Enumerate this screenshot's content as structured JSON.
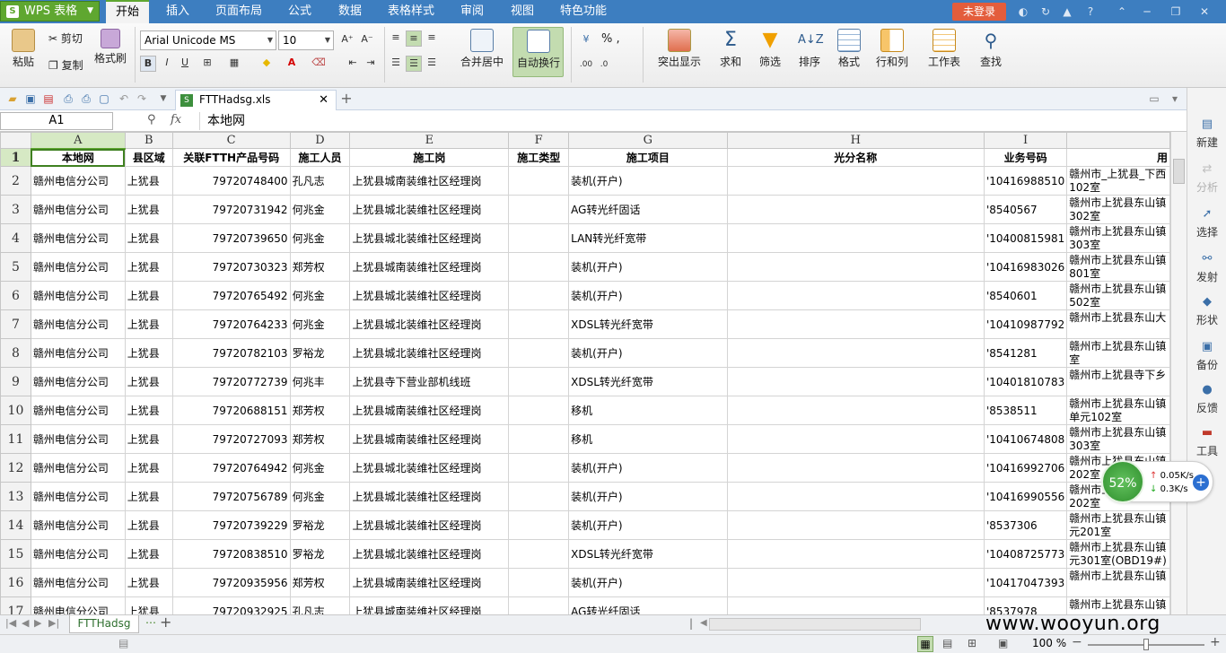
{
  "app": {
    "name": "WPS 表格",
    "login": "未登录"
  },
  "tabs": [
    "开始",
    "插入",
    "页面布局",
    "公式",
    "数据",
    "表格样式",
    "审阅",
    "视图",
    "特色功能"
  ],
  "ribbon": {
    "paste": "粘贴",
    "cut": "剪切",
    "copy": "复制",
    "format_painter": "格式刷",
    "font_name": "Arial Unicode MS",
    "font_size": "10",
    "merge_center": "合并居中",
    "auto_wrap": "自动换行",
    "highlight": "突出显示",
    "sum": "求和",
    "filter": "筛选",
    "sort": "排序",
    "format": "格式",
    "row_col": "行和列",
    "worksheet": "工作表",
    "find": "查找",
    "number_format": "% ,"
  },
  "document": {
    "tab_name": "FTTHadsg.xls"
  },
  "formula": {
    "cell_ref": "A1",
    "fx": "fx",
    "value": "本地网"
  },
  "columns": [
    "A",
    "B",
    "C",
    "D",
    "E",
    "F",
    "G",
    "H",
    "I",
    ""
  ],
  "header_row": [
    "本地网",
    "县区域",
    "关联FTTH产品号码",
    "施工人员",
    "施工岗",
    "施工类型",
    "施工项目",
    "光分名称",
    "业务号码",
    "用"
  ],
  "rows": [
    {
      "n": "2",
      "cells": [
        "赣州电信分公司",
        "上犹县",
        "79720748400",
        "孔凡志",
        "上犹县城南装维社区经理岗",
        "",
        "装机(开户)",
        "",
        "'10416988510",
        "赣州市_上犹县_下西102室"
      ]
    },
    {
      "n": "3",
      "cells": [
        "赣州电信分公司",
        "上犹县",
        "79720731942",
        "何兆金",
        "上犹县城北装维社区经理岗",
        "",
        "AG转光纤固话",
        "",
        "'8540567",
        "赣州市上犹县东山镇302室"
      ]
    },
    {
      "n": "4",
      "cells": [
        "赣州电信分公司",
        "上犹县",
        "79720739650",
        "何兆金",
        "上犹县城北装维社区经理岗",
        "",
        "LAN转光纤宽带",
        "",
        "'10400815981",
        "赣州市上犹县东山镇303室"
      ]
    },
    {
      "n": "5",
      "cells": [
        "赣州电信分公司",
        "上犹县",
        "79720730323",
        "郑芳权",
        "上犹县城南装维社区经理岗",
        "",
        "装机(开户)",
        "",
        "'10416983026",
        "赣州市上犹县东山镇801室"
      ]
    },
    {
      "n": "6",
      "cells": [
        "赣州电信分公司",
        "上犹县",
        "79720765492",
        "何兆金",
        "上犹县城北装维社区经理岗",
        "",
        "装机(开户)",
        "",
        "'8540601",
        "赣州市上犹县东山镇502室"
      ]
    },
    {
      "n": "7",
      "cells": [
        "赣州电信分公司",
        "上犹县",
        "79720764233",
        "何兆金",
        "上犹县城北装维社区经理岗",
        "",
        "XDSL转光纤宽带",
        "",
        "'10410987792",
        "赣州市上犹县东山大"
      ]
    },
    {
      "n": "8",
      "cells": [
        "赣州电信分公司",
        "上犹县",
        "79720782103",
        "罗裕龙",
        "上犹县城北装维社区经理岗",
        "",
        "装机(开户)",
        "",
        "'8541281",
        "赣州市上犹县东山镇室"
      ]
    },
    {
      "n": "9",
      "cells": [
        "赣州电信分公司",
        "上犹县",
        "79720772739",
        "何兆丰",
        "上犹县寺下营业部机线班",
        "",
        "XDSL转光纤宽带",
        "",
        "'10401810783",
        "赣州市上犹县寺下乡"
      ]
    },
    {
      "n": "10",
      "cells": [
        "赣州电信分公司",
        "上犹县",
        "79720688151",
        "郑芳权",
        "上犹县城南装维社区经理岗",
        "",
        "移机",
        "",
        "'8538511",
        "赣州市上犹县东山镇单元102室"
      ]
    },
    {
      "n": "11",
      "cells": [
        "赣州电信分公司",
        "上犹县",
        "79720727093",
        "郑芳权",
        "上犹县城南装维社区经理岗",
        "",
        "移机",
        "",
        "'10410674808",
        "赣州市上犹县东山镇303室"
      ]
    },
    {
      "n": "12",
      "cells": [
        "赣州电信分公司",
        "上犹县",
        "79720764942",
        "何兆金",
        "上犹县城北装维社区经理岗",
        "",
        "装机(开户)",
        "",
        "'10416992706",
        "赣州市上犹县东山镇202室"
      ]
    },
    {
      "n": "13",
      "cells": [
        "赣州电信分公司",
        "上犹县",
        "79720756789",
        "何兆金",
        "上犹县城北装维社区经理岗",
        "",
        "装机(开户)",
        "",
        "'10416990556",
        "赣州市上犹县东山镇202室"
      ]
    },
    {
      "n": "14",
      "cells": [
        "赣州电信分公司",
        "上犹县",
        "79720739229",
        "罗裕龙",
        "上犹县城北装维社区经理岗",
        "",
        "装机(开户)",
        "",
        "'8537306",
        "赣州市上犹县东山镇元201室"
      ]
    },
    {
      "n": "15",
      "cells": [
        "赣州电信分公司",
        "上犹县",
        "79720838510",
        "罗裕龙",
        "上犹县城北装维社区经理岗",
        "",
        "XDSL转光纤宽带",
        "",
        "'10408725773",
        "赣州市上犹县东山镇元301室(OBD19#)"
      ]
    },
    {
      "n": "16",
      "cells": [
        "赣州电信分公司",
        "上犹县",
        "79720935956",
        "郑芳权",
        "上犹县城南装维社区经理岗",
        "",
        "装机(开户)",
        "",
        "'10417047393",
        "赣州市上犹县东山镇"
      ]
    },
    {
      "n": "17",
      "cells": [
        "赣州电信分公司",
        "上犹县",
        "79720932925",
        "孔凡志",
        "上犹县城南装维社区经理岗",
        "",
        "AG转光纤固话",
        "",
        "'8537978",
        "赣州市上犹县东山镇"
      ]
    }
  ],
  "sidepanel": [
    "新建",
    "分析",
    "选择",
    "发射",
    "形状",
    "备份",
    "反馈",
    "工具"
  ],
  "sheet": {
    "name": "FTTHadsg"
  },
  "status": {
    "zoom": "100 %"
  },
  "network": {
    "percent": "52%",
    "up": "0.05K/s",
    "down": "0.3K/s"
  },
  "watermark": "www.wooyun.org"
}
